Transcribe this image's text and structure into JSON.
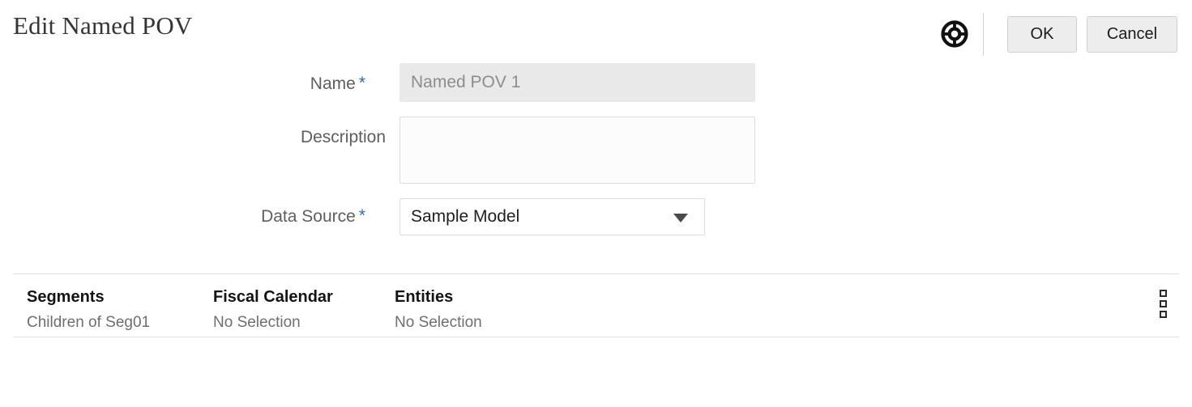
{
  "header": {
    "title": "Edit Named POV",
    "help_icon": "life-ring-help-icon",
    "ok_label": "OK",
    "cancel_label": "Cancel"
  },
  "form": {
    "name": {
      "label": "Name",
      "required_marker": "*",
      "value": "Named POV 1",
      "placeholder": "Named POV 1"
    },
    "description": {
      "label": "Description",
      "value": "",
      "placeholder": ""
    },
    "data_source": {
      "label": "Data Source",
      "required_marker": "*",
      "value": "Sample Model",
      "arrow_icon": "chevron-down-icon"
    }
  },
  "segments_table": {
    "menu_icon": "kebab-menu-icon",
    "columns": [
      {
        "header": "Segments",
        "value": "Children of Seg01"
      },
      {
        "header": "Fiscal Calendar",
        "value": "No Selection"
      },
      {
        "header": "Entities",
        "value": "No Selection"
      }
    ]
  },
  "colors": {
    "required_star": "#2e6ca8",
    "button_face": "#ededed",
    "disabled_field": "#e9e9e9",
    "border": "#dcdcdc"
  }
}
